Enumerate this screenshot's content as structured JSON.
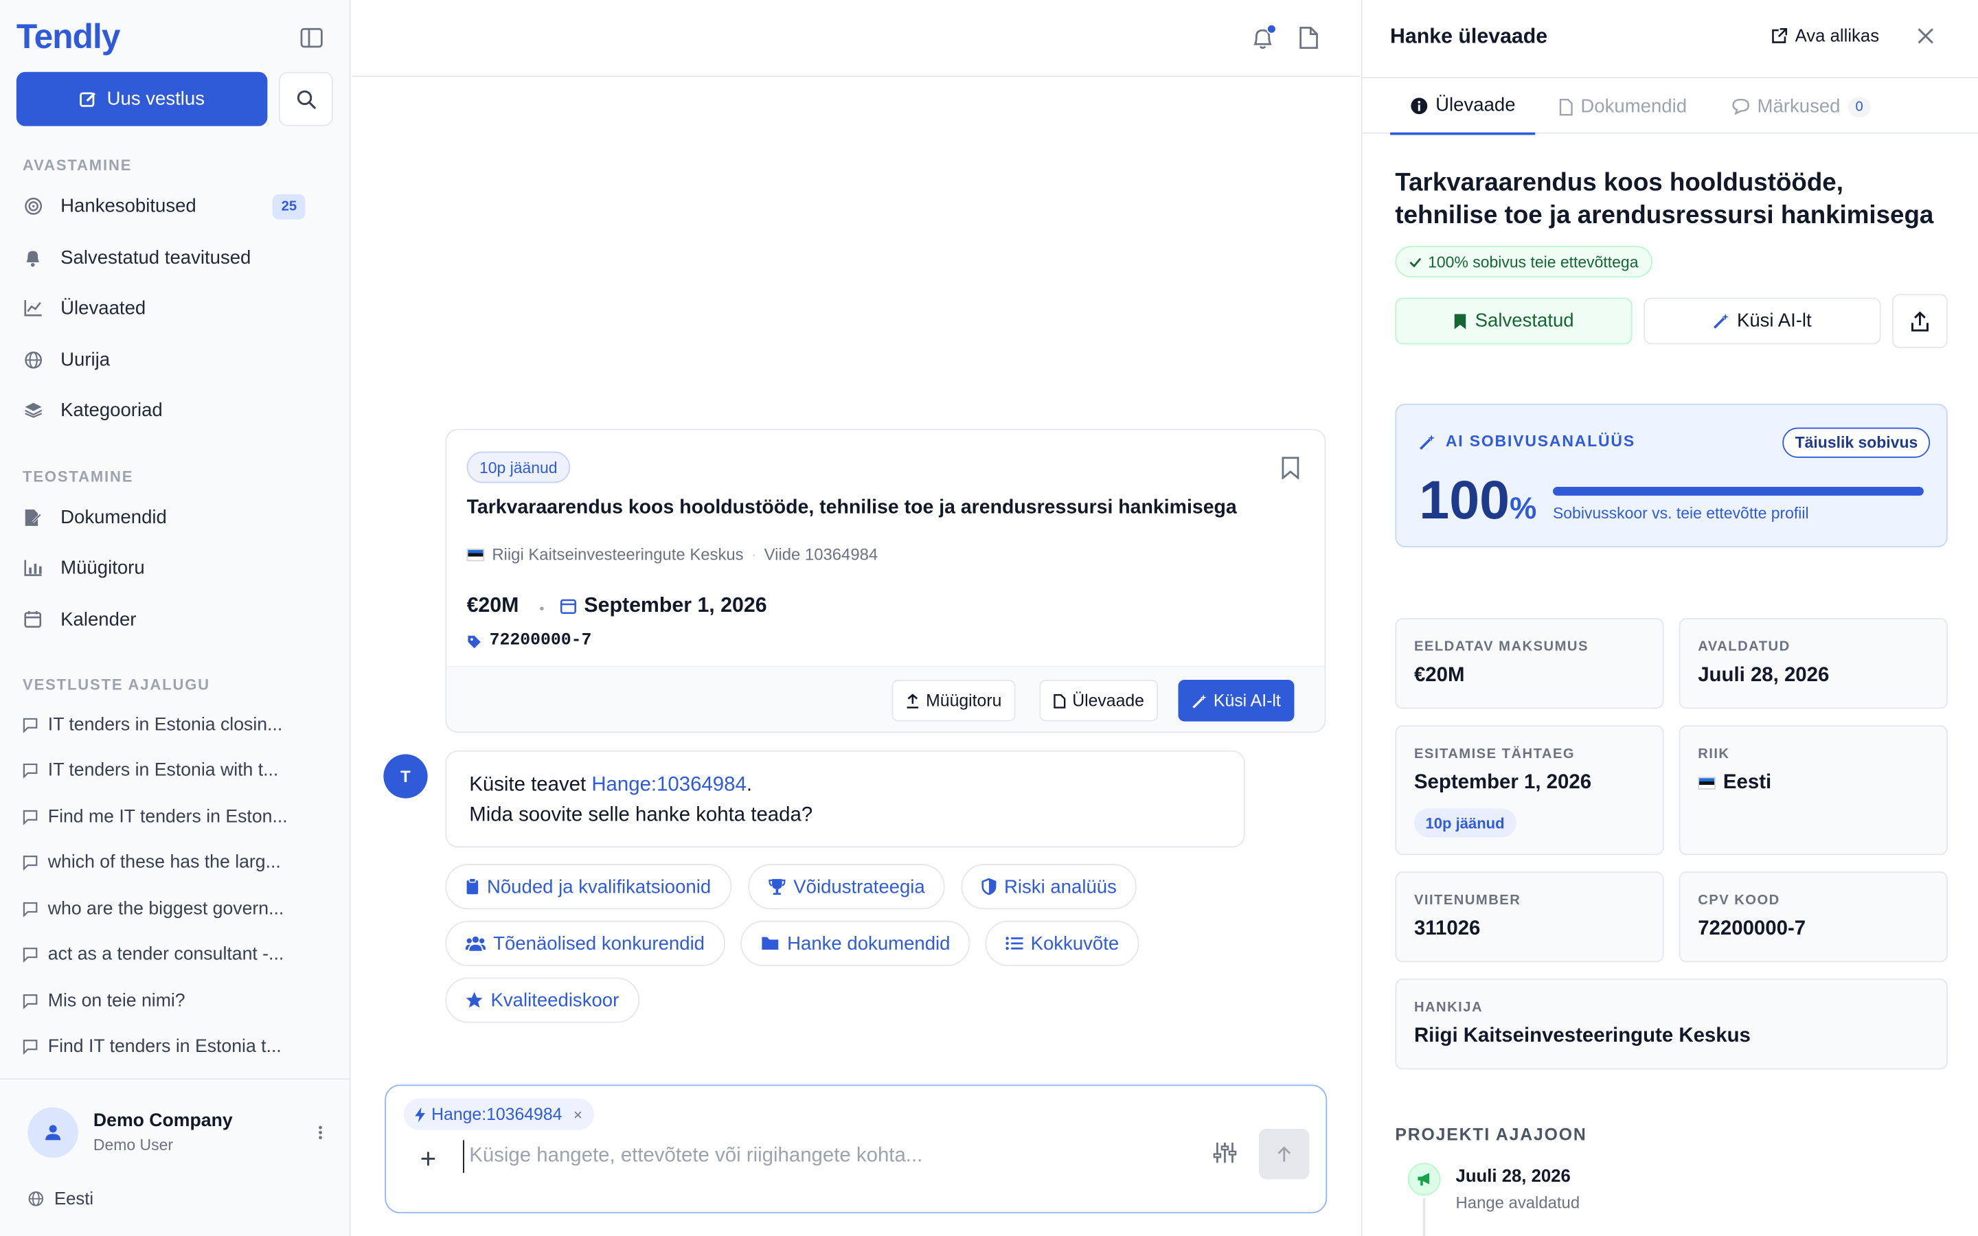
{
  "brand": {
    "name": "Tendly",
    "accent": "#2f5bd8"
  },
  "sidebar": {
    "new_chat": "Uus vestlus",
    "section_discover": "AVASTAMINE",
    "discover_items": [
      {
        "label": "Hankesobitused",
        "badge": "25",
        "icon": "target-icon"
      },
      {
        "label": "Salvestatud teavitused",
        "icon": "bell-icon"
      },
      {
        "label": "Ülevaated",
        "icon": "chart-line-icon"
      },
      {
        "label": "Uurija",
        "icon": "globe-icon"
      },
      {
        "label": "Kategooriad",
        "icon": "layers-icon"
      }
    ],
    "section_execute": "TEOSTAMINE",
    "execute_items": [
      {
        "label": "Dokumendid",
        "icon": "file-edit-icon"
      },
      {
        "label": "Müügitoru",
        "icon": "bar-chart-icon"
      },
      {
        "label": "Kalender",
        "icon": "calendar-icon"
      }
    ],
    "section_history": "VESTLUSTE AJALUGU",
    "history": [
      "IT tenders in Estonia closin...",
      "IT tenders in Estonia with t...",
      "Find me IT tenders in Eston...",
      "which of these has the larg...",
      "who are the biggest govern...",
      "act as a tender consultant -...",
      "Mis on teie nimi?",
      "Find IT tenders in Estonia t..."
    ],
    "user": {
      "company": "Demo Company",
      "name": "Demo User"
    },
    "language": "Eesti"
  },
  "card": {
    "days_left": "10p jäänud",
    "title": "Tarkvaraarendus koos hooldustööde, tehnilise toe ja arendusressursi hankimisega",
    "org": "Riigi Kaitseinvesteeringute Keskus",
    "ref": "Viide 10364984",
    "value": "€20M",
    "deadline": "September 1, 2026",
    "cpv": "72200000-7",
    "btn_pipeline": "Müügitoru",
    "btn_overview": "Ülevaade",
    "btn_ask": "Küsi AI-lt"
  },
  "message": {
    "avatar": "T",
    "line1_prefix": "Küsite teavet",
    "line1_ref": "Hange:10364984",
    "line1_suffix": ".",
    "line2": "Mida soovite selle hanke kohta teada?"
  },
  "suggestions": [
    "Nõuded ja kvalifikatsioonid",
    "Võidustrateegia",
    "Riski analüüs",
    "Tõenäolised konkurendid",
    "Hanke dokumendid",
    "Kokkuvõte",
    "Kvaliteediskoor"
  ],
  "composer": {
    "tag": "Hange:10364984",
    "tag_remove": "×",
    "placeholder": "Küsige hangete, ettevõtete või riigihangete kohta..."
  },
  "panel": {
    "title": "Hanke ülevaade",
    "open_source": "Ava allikas",
    "tabs": [
      {
        "label": "Ülevaade",
        "active": true
      },
      {
        "label": "Dokumendid"
      },
      {
        "label": "Märkused",
        "count": "0"
      }
    ],
    "tender_title": "Tarkvaraarendus koos hooldustööde, tehnilise toe ja arendusressursi hankimisega",
    "match": "100% sobivus teie ettevõttega",
    "saved": "Salvestatud",
    "ask": "Küsi AI-lt",
    "ai": {
      "label": "AI SOBIVUSANALÜÜS",
      "pill": "Täiuslik sobivus",
      "score": "100",
      "pct": "%",
      "fraction": 1.0,
      "sub": "Sobivusskoor vs. teie ettevõtte profiil"
    },
    "fields": {
      "est_value_label": "EELDATAV MAKSUMUS",
      "est_value": "€20M",
      "published_label": "AVALDATUD",
      "published": "Juuli 28, 2026",
      "deadline_label": "ESITAMISE TÄHTAEG",
      "deadline": "September 1, 2026",
      "deadline_pill": "10p jäänud",
      "country_label": "RIIK",
      "country": "Eesti",
      "refnum_label": "VIITENUMBER",
      "refnum": "311026",
      "cpv_label": "CPV KOOD",
      "cpv": "72200000-7",
      "buyer_label": "HANKIJA",
      "buyer": "Riigi Kaitseinvesteeringute Keskus"
    },
    "timeline": {
      "title": "PROJEKTI AJAJOON",
      "date": "Juuli 28, 2026",
      "desc": "Hange avaldatud"
    }
  }
}
